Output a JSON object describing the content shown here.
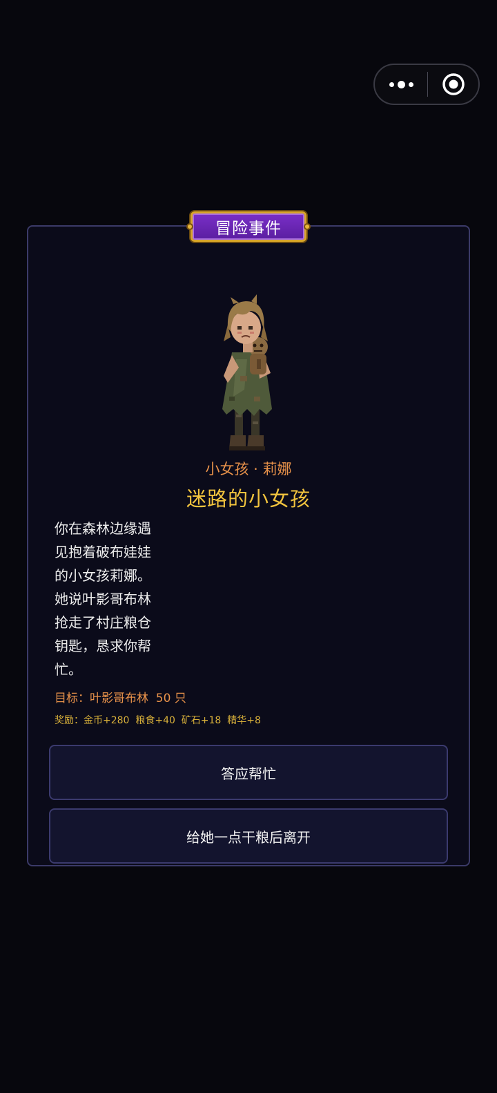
{
  "capsule": {
    "more_icon": "more-dots-icon",
    "close_icon": "target-circle-icon"
  },
  "event": {
    "badge": "冒险事件",
    "npc_name": "小女孩 · 莉娜",
    "title": "迷路的小女孩",
    "description": "你在森林边缘遇见抱着破布娃娃的小女孩莉娜。她说叶影哥布林抢走了村庄粮仓钥匙，恳求你帮忙。",
    "objective": "目标：叶影哥布林  50 只",
    "reward": "奖励：金币+280  粮食+40  矿石+18  精华+8"
  },
  "choices": {
    "accept": "答应帮忙",
    "leave": "给她一点干粮后离开"
  },
  "colors": {
    "background": "#07070d",
    "panel_border": "#3b3a68",
    "badge_purple": "#6a28b8",
    "badge_gold": "#d9a62a",
    "npc_name": "#e8924a",
    "title": "#f2c43e",
    "reward": "#d8b03a"
  }
}
